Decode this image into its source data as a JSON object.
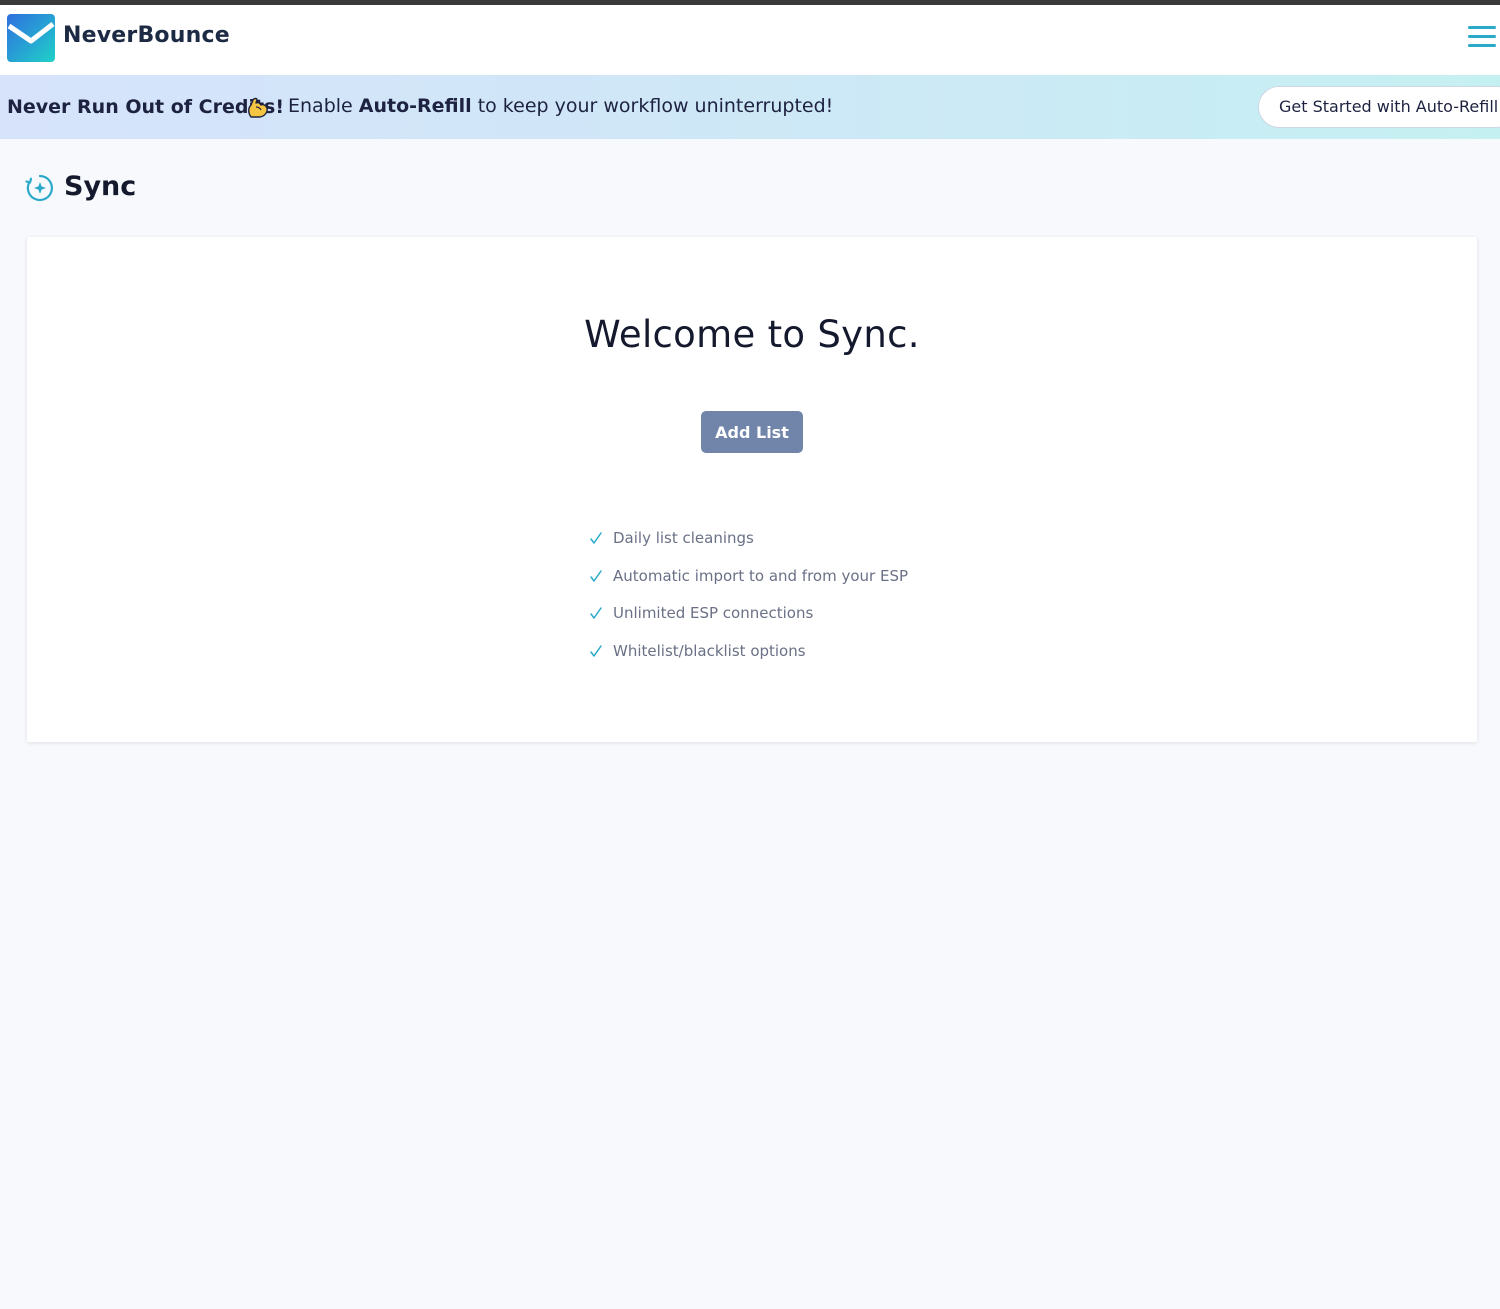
{
  "header": {
    "brand": "NeverBounce",
    "logo_icon": "envelope-logo-icon",
    "menu_icon": "hamburger-menu-icon"
  },
  "banner": {
    "headline": "Never Run Out of Credits!",
    "icon": "flexed-biceps-icon",
    "text_before": "Enable ",
    "text_bold": "Auto-Refill",
    "text_after": " to keep your workflow uninterrupted!",
    "button_label": "Get Started with Auto-Refill"
  },
  "page": {
    "title": "Sync",
    "title_icon": "sync-icon"
  },
  "welcome": {
    "heading": "Welcome to Sync.",
    "add_list_label": "Add List",
    "features": [
      "Daily list cleanings",
      "Automatic import to and from your ESP",
      "Unlimited ESP connections",
      "Whitelist/blacklist options"
    ]
  },
  "colors": {
    "accent": "#2aa9c9",
    "button": "#7185ab",
    "text_dark": "#15192e",
    "text_muted": "#6a7186",
    "background": "#f8f9fc"
  }
}
